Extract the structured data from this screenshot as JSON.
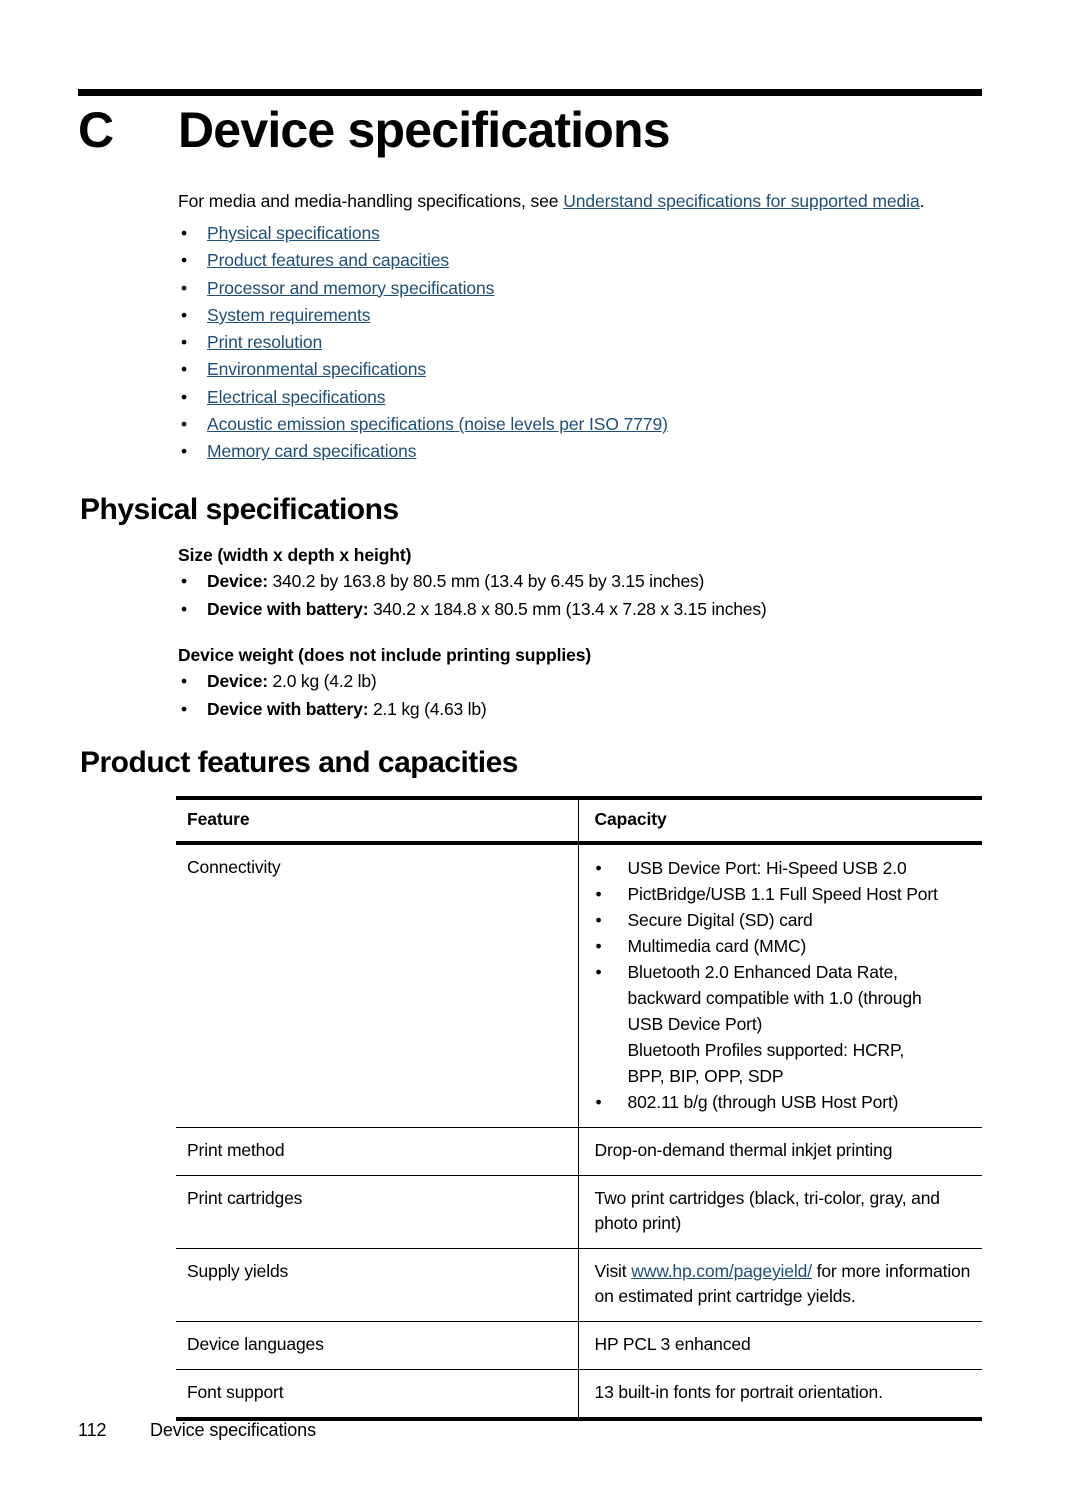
{
  "chapter": {
    "letter": "C",
    "title": "Device specifications"
  },
  "intro": {
    "lead": "For media and media-handling specifications, see ",
    "link": "Understand specifications for supported media",
    "tail": "."
  },
  "toc": {
    "bullet": "•",
    "items": [
      {
        "label": "Physical specifications"
      },
      {
        "label": "Product features and capacities"
      },
      {
        "label": "Processor and memory specifications"
      },
      {
        "label": "System requirements"
      },
      {
        "label": "Print resolution"
      },
      {
        "label": "Environmental specifications"
      },
      {
        "label": "Electrical specifications"
      },
      {
        "label": "Acoustic emission specifications (noise levels per ISO 7779)"
      },
      {
        "label": "Memory card specifications"
      }
    ]
  },
  "sections": {
    "physical_heading": "Physical specifications",
    "product_heading": "Product features and capacities"
  },
  "physical": {
    "size_subhead": "Size (width x depth x height)",
    "size_items": [
      {
        "label": "Device:",
        "value": " 340.2 by 163.8 by 80.5 mm (13.4 by 6.45 by 3.15 inches)"
      },
      {
        "label": "Device with battery:",
        "value": " 340.2 x 184.8 x 80.5 mm (13.4 x 7.28 x 3.15 inches)"
      }
    ],
    "weight_subhead": "Device weight (does not include printing supplies)",
    "weight_items": [
      {
        "label": "Device:",
        "value": " 2.0 kg (4.2 lb)"
      },
      {
        "label": "Device with battery:",
        "value": " 2.1 kg (4.63 lb)"
      }
    ]
  },
  "table": {
    "headers": {
      "feature": "Feature",
      "capacity": "Capacity"
    },
    "rows": [
      {
        "feature": "Connectivity",
        "capacity_bullets": [
          {
            "lines": [
              "USB Device Port: Hi-Speed USB 2.0"
            ]
          },
          {
            "lines": [
              "PictBridge/USB 1.1 Full Speed Host Port"
            ]
          },
          {
            "lines": [
              "Secure Digital (SD) card"
            ]
          },
          {
            "lines": [
              "Multimedia card (MMC)"
            ]
          },
          {
            "lines": [
              "Bluetooth 2.0 Enhanced Data Rate,",
              "backward compatible with 1.0 (through",
              "USB Device Port)",
              "Bluetooth Profiles supported: HCRP,",
              "BPP, BIP, OPP, SDP"
            ]
          },
          {
            "lines": [
              "802.11 b/g (through USB Host Port)"
            ]
          }
        ]
      },
      {
        "feature": "Print method",
        "capacity_text": "Drop-on-demand thermal inkjet printing"
      },
      {
        "feature": "Print cartridges",
        "capacity_text": "Two print cartridges (black, tri-color, gray, and photo print)"
      },
      {
        "feature": "Supply yields",
        "capacity_prefix": "Visit ",
        "capacity_link": "www.hp.com/pageyield/",
        "capacity_suffix": " for more information on estimated print cartridge yields."
      },
      {
        "feature": "Device languages",
        "capacity_text": "HP PCL 3 enhanced"
      },
      {
        "feature": "Font support",
        "capacity_text": "13 built-in fonts for portrait orientation."
      }
    ]
  },
  "footer": {
    "page_number": "112",
    "section_name": "Device specifications"
  },
  "colors": {
    "link": "#1F4E79",
    "rule": "#000000",
    "text": "#000000"
  }
}
